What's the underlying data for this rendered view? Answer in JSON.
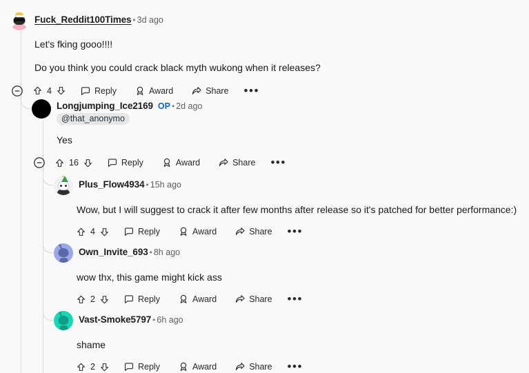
{
  "page": {
    "background_color": "#f9f9f9",
    "text_color": "#17181a",
    "op_badge_color": "#1464c0",
    "thread_line_color": "#d9dadb",
    "mention_chip_bg": "#e4e6e7"
  },
  "labels": {
    "reply": "Reply",
    "award": "Award",
    "share": "Share",
    "more": "•••",
    "separator": "•"
  },
  "comments": [
    {
      "id": "c1",
      "depth": 0,
      "username": "Fuck_Reddit100Times",
      "username_underlined": true,
      "op": false,
      "age": "3d ago",
      "mention": null,
      "avatar": "snoo-sunglasses-avatar",
      "avatar_color": "#f0f0f2",
      "paragraphs": [
        "Let's fking gooo!!!!",
        "Do you think you could crack black myth wukong when it releases?"
      ],
      "votes": "4",
      "has_collapse": true
    },
    {
      "id": "c2",
      "depth": 1,
      "username": "Longjumping_Ice2169",
      "username_underlined": false,
      "op": true,
      "op_label": "OP",
      "age": "2d ago",
      "mention": "@that_anonymo",
      "avatar": "snoo-black-avatar",
      "avatar_color": "#000000",
      "paragraphs": [
        "Yes"
      ],
      "votes": "16",
      "has_collapse": true
    },
    {
      "id": "c3",
      "depth": 2,
      "username": "Plus_Flow4934",
      "username_underlined": false,
      "op": false,
      "age": "15h ago",
      "mention": null,
      "avatar": "snoo-tree-hat-avatar",
      "avatar_color": "#f0f0f2",
      "paragraphs": [
        "Wow, but I will suggest to crack it after few months after release so it's patched for better performance:)"
      ],
      "votes": "4",
      "has_collapse": false
    },
    {
      "id": "c4",
      "depth": 2,
      "username": "Own_Invite_693",
      "username_underlined": false,
      "op": false,
      "age": "8h ago",
      "mention": null,
      "avatar": "snoo-blue-avatar",
      "avatar_color": "#9aa7e8",
      "paragraphs": [
        "wow thx, this game might kick ass"
      ],
      "votes": "2",
      "has_collapse": false
    },
    {
      "id": "c5",
      "depth": 2,
      "username": "Vast-Smoke5797",
      "username_underlined": false,
      "op": false,
      "age": "6h ago",
      "mention": null,
      "avatar": "snoo-teal-avatar",
      "avatar_color": "#19d6b5",
      "paragraphs": [
        "shame"
      ],
      "votes": "2",
      "has_collapse": false
    }
  ]
}
